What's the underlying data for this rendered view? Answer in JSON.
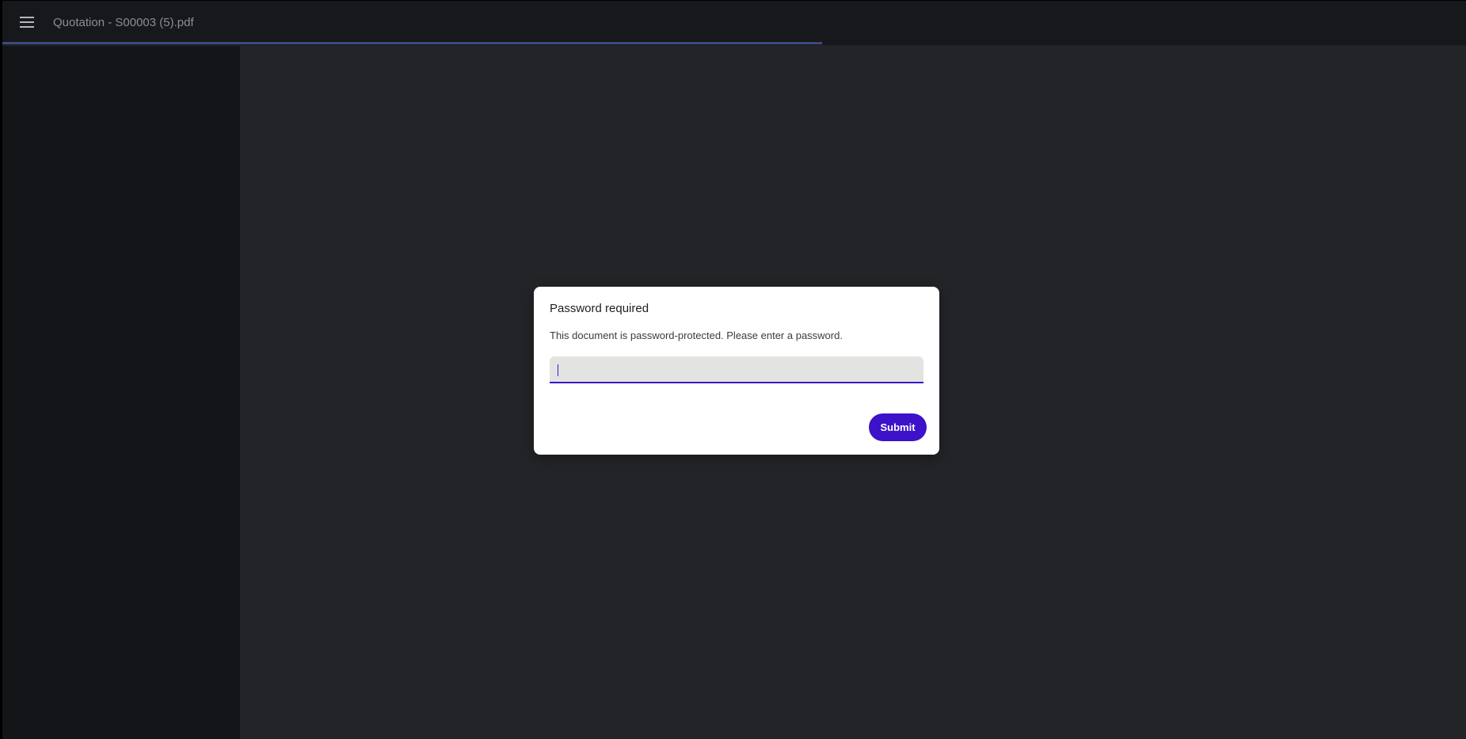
{
  "toolbar": {
    "menu_icon": "hamburger-menu-icon",
    "document_title": "Quotation - S00003 (5).pdf",
    "load_progress_percent": 56,
    "progress_color": "#3e4a7e"
  },
  "dialog": {
    "title": "Password required",
    "message": "This document is password-protected. Please enter a password.",
    "password_value": "",
    "submit_label": "Submit",
    "accent_color": "#3d12c9"
  }
}
